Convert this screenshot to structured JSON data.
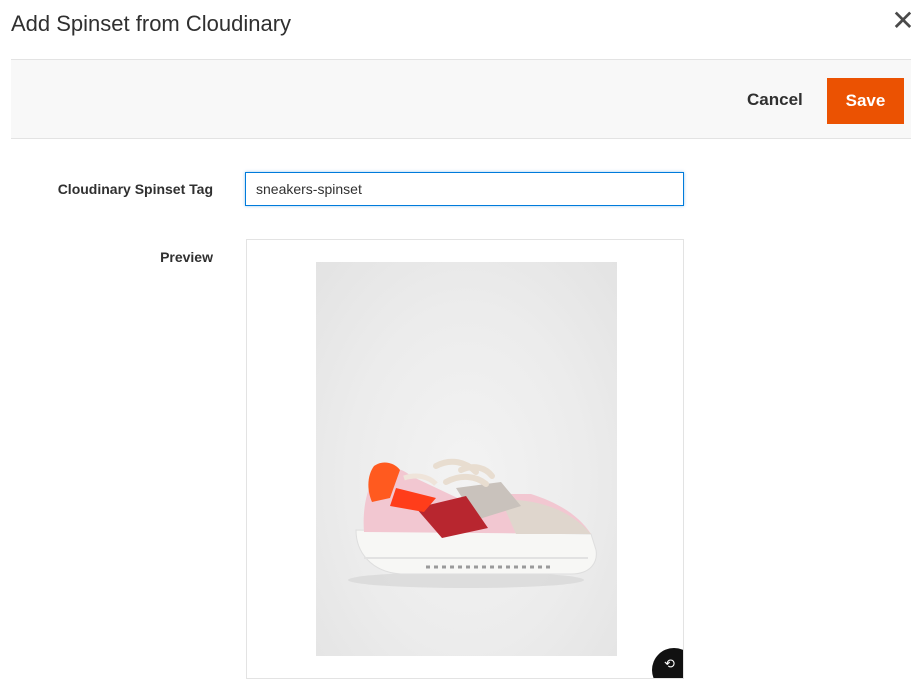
{
  "modal": {
    "title": "Add Spinset from Cloudinary",
    "close_glyph": "✕"
  },
  "toolbar": {
    "cancel_label": "Cancel",
    "save_label": "Save"
  },
  "form": {
    "tag_label": "Cloudinary Spinset Tag",
    "tag_value": "sneakers-spinset",
    "preview_label": "Preview"
  },
  "preview": {
    "image_subject": "sneaker",
    "spin_icon": "360-rotate-icon"
  },
  "colors": {
    "accent": "#eb5202",
    "focus": "#007bdb",
    "toolbar_bg": "#f8f8f8"
  }
}
